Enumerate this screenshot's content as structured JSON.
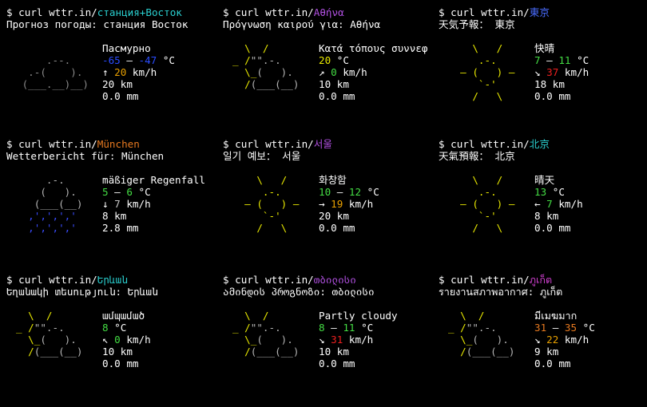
{
  "panels": [
    {
      "cmd_prefix": "$ curl wttr.in/",
      "city": "станция+Восток",
      "city_color": "#2ad0d0",
      "report_label": "Прогноз погоды: станция Восток",
      "condition": "Пасмурно",
      "temp_a": "-65",
      "temp_sep": " – ",
      "temp_b": "-47",
      "temp_unit": " °C",
      "temp_a_color": "#2a4cff",
      "temp_b_color": "#2a4cff",
      "wind_arrow": "↑ ",
      "wind_value": "20",
      "wind_unit": " km/h",
      "wind_color": "#e8a000",
      "visibility": "20 km",
      "precip": "0.0 mm",
      "art_type": "overcast"
    },
    {
      "cmd_prefix": "$ curl wttr.in/",
      "city": "Αθήνα",
      "city_color": "#b050e0",
      "report_label": "Πρόγνωση καιρού για: Αθήνα",
      "condition": "Κατά τόπους συννεφ",
      "temp_a": "20",
      "temp_sep": "",
      "temp_b": "",
      "temp_unit": " °C",
      "temp_a_color": "#e8e800",
      "temp_b_color": "#e8e800",
      "wind_arrow": "↗ ",
      "wind_value": "0",
      "wind_unit": " km/h",
      "wind_color": "#44dd44",
      "visibility": "10 km",
      "precip": "0.0 mm",
      "art_type": "partly"
    },
    {
      "cmd_prefix": "$ curl wttr.in/",
      "city": "東京",
      "city_color": "#4a6cff",
      "report_label": "天気予報： 東京",
      "condition": "快晴",
      "temp_a": "7",
      "temp_sep": " – ",
      "temp_b": "11",
      "temp_unit": " °C",
      "temp_a_color": "#44dd44",
      "temp_b_color": "#44dd44",
      "wind_arrow": "↘ ",
      "wind_value": "37",
      "wind_unit": " km/h",
      "wind_color": "#ee2020",
      "visibility": "18 km",
      "precip": "0.0 mm",
      "art_type": "sunny"
    },
    {
      "cmd_prefix": "$ curl wttr.in/",
      "city": "München",
      "city_color": "#e87a20",
      "report_label": "Wetterbericht für: München",
      "condition": "mäßiger Regenfall",
      "temp_a": "5",
      "temp_sep": " – ",
      "temp_b": "6",
      "temp_unit": " °C",
      "temp_a_color": "#44dd44",
      "temp_b_color": "#44dd44",
      "wind_arrow": "↓ ",
      "wind_value": "7",
      "wind_unit": " km/h",
      "wind_color": "#c8c8c8",
      "visibility": "8 km",
      "precip": "2.8 mm",
      "art_type": "rain"
    },
    {
      "cmd_prefix": "$ curl wttr.in/",
      "city": "서울",
      "city_color": "#b050e0",
      "report_label": "일기 예보： 서울",
      "condition": "화창함",
      "temp_a": "10",
      "temp_sep": " – ",
      "temp_b": "12",
      "temp_unit": " °C",
      "temp_a_color": "#44dd44",
      "temp_b_color": "#44dd44",
      "wind_arrow": "→ ",
      "wind_value": "19",
      "wind_unit": " km/h",
      "wind_color": "#e8a000",
      "visibility": "20 km",
      "precip": "0.0 mm",
      "art_type": "sunny"
    },
    {
      "cmd_prefix": "$ curl wttr.in/",
      "city": "北京",
      "city_color": "#2ad0d0",
      "report_label": "天氣預報： 北京",
      "condition": "晴天",
      "temp_a": "13",
      "temp_sep": "",
      "temp_b": "",
      "temp_unit": " °C",
      "temp_a_color": "#44dd44",
      "temp_b_color": "#44dd44",
      "wind_arrow": "← ",
      "wind_value": "7",
      "wind_unit": " km/h",
      "wind_color": "#44dd44",
      "visibility": "8 km",
      "precip": "0.0 mm",
      "art_type": "sunny"
    },
    {
      "cmd_prefix": "$ curl wttr.in/",
      "city": "Երևան",
      "city_color": "#2ad0d0",
      "report_label": "Եղանակի տեսություն: Երևան",
      "condition": "ամպամած",
      "temp_a": "8",
      "temp_sep": "",
      "temp_b": "",
      "temp_unit": " °C",
      "temp_a_color": "#44dd44",
      "temp_b_color": "#44dd44",
      "wind_arrow": "↖ ",
      "wind_value": "0",
      "wind_unit": " km/h",
      "wind_color": "#44dd44",
      "visibility": "10 km",
      "precip": "0.0 mm",
      "art_type": "partly"
    },
    {
      "cmd_prefix": "$ curl wttr.in/",
      "city": "თბილისი",
      "city_color": "#b050e0",
      "report_label": "ამინდის პროგნოზი: თბილისი",
      "condition": "Partly cloudy",
      "temp_a": "8",
      "temp_sep": " – ",
      "temp_b": "11",
      "temp_unit": " °C",
      "temp_a_color": "#44dd44",
      "temp_b_color": "#44dd44",
      "wind_arrow": "↘ ",
      "wind_value": "31",
      "wind_unit": " km/h",
      "wind_color": "#ee2020",
      "visibility": "10 km",
      "precip": "0.0 mm",
      "art_type": "partly"
    },
    {
      "cmd_prefix": "$ curl wttr.in/",
      "city": "ภูเก็ต",
      "city_color": "#d040d0",
      "report_label": "รายงานสภาพอากาศ: ภูเก็ต",
      "condition": "มีเมฆมาก",
      "temp_a": "31",
      "temp_sep": " – ",
      "temp_b": "35",
      "temp_unit": " °C",
      "temp_a_color": "#e87a20",
      "temp_b_color": "#e87a20",
      "wind_arrow": "↘ ",
      "wind_value": "22",
      "wind_unit": " km/h",
      "wind_color": "#e8a000",
      "visibility": "9 km",
      "precip": "0.0 mm",
      "art_type": "partly"
    }
  ],
  "art": {
    "overcast": [
      "     .--.    ",
      "  .-(    ).  ",
      " (___.__)__) ",
      "             "
    ],
    "partly": [
      "  \\  /       ",
      "_ /\"\".-.     ",
      "  \\_(   ).   ",
      "  /(___(__)  "
    ],
    "sunny": [
      "    \\   /    ",
      "     .-.     ",
      "  ― (   ) ―  ",
      "     `-'     ",
      "    /   \\    "
    ],
    "rain": [
      "     .-.     ",
      "    (   ).   ",
      "   (___(__)  ",
      "  ‚'‚'‚'‚'   ",
      "  ‚'‚'‚'‚'   "
    ]
  }
}
